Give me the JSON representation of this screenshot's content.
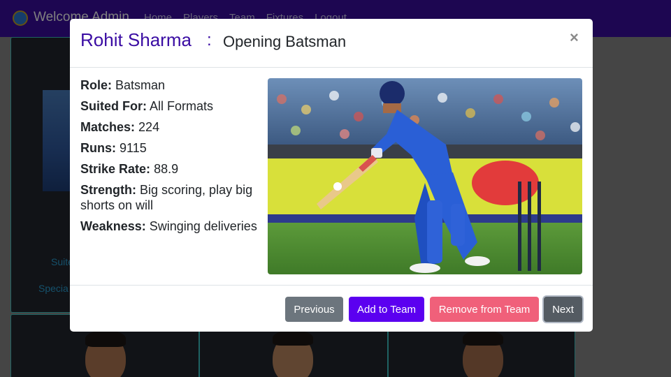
{
  "navbar": {
    "brand": "Welcome Admin",
    "links": [
      "Home",
      "Players",
      "Team",
      "Fixtures",
      "Logout"
    ]
  },
  "background": {
    "card_texts": [
      "Suite",
      "Specia"
    ]
  },
  "modal": {
    "player_name": "Rohit Sharma",
    "separator": ":",
    "player_title": "Opening Batsman",
    "close_symbol": "×",
    "details": [
      {
        "label": "Role:",
        "value": "Batsman"
      },
      {
        "label": "Suited For:",
        "value": "All Formats"
      },
      {
        "label": "Matches:",
        "value": "224"
      },
      {
        "label": "Runs:",
        "value": "9115"
      },
      {
        "label": "Strike Rate:",
        "value": "88.9"
      },
      {
        "label": "Strength:",
        "value": "Big scoring, play big shorts on will"
      },
      {
        "label": "Weakness:",
        "value": "Swinging deliveries"
      }
    ],
    "buttons": {
      "previous": "Previous",
      "add": "Add to Team",
      "remove": "Remove from Team",
      "next": "Next"
    }
  },
  "colors": {
    "navbar": "#3a0ca3",
    "primary": "#5b00f0",
    "danger": "#f0607a",
    "secondary": "#6c757d"
  }
}
